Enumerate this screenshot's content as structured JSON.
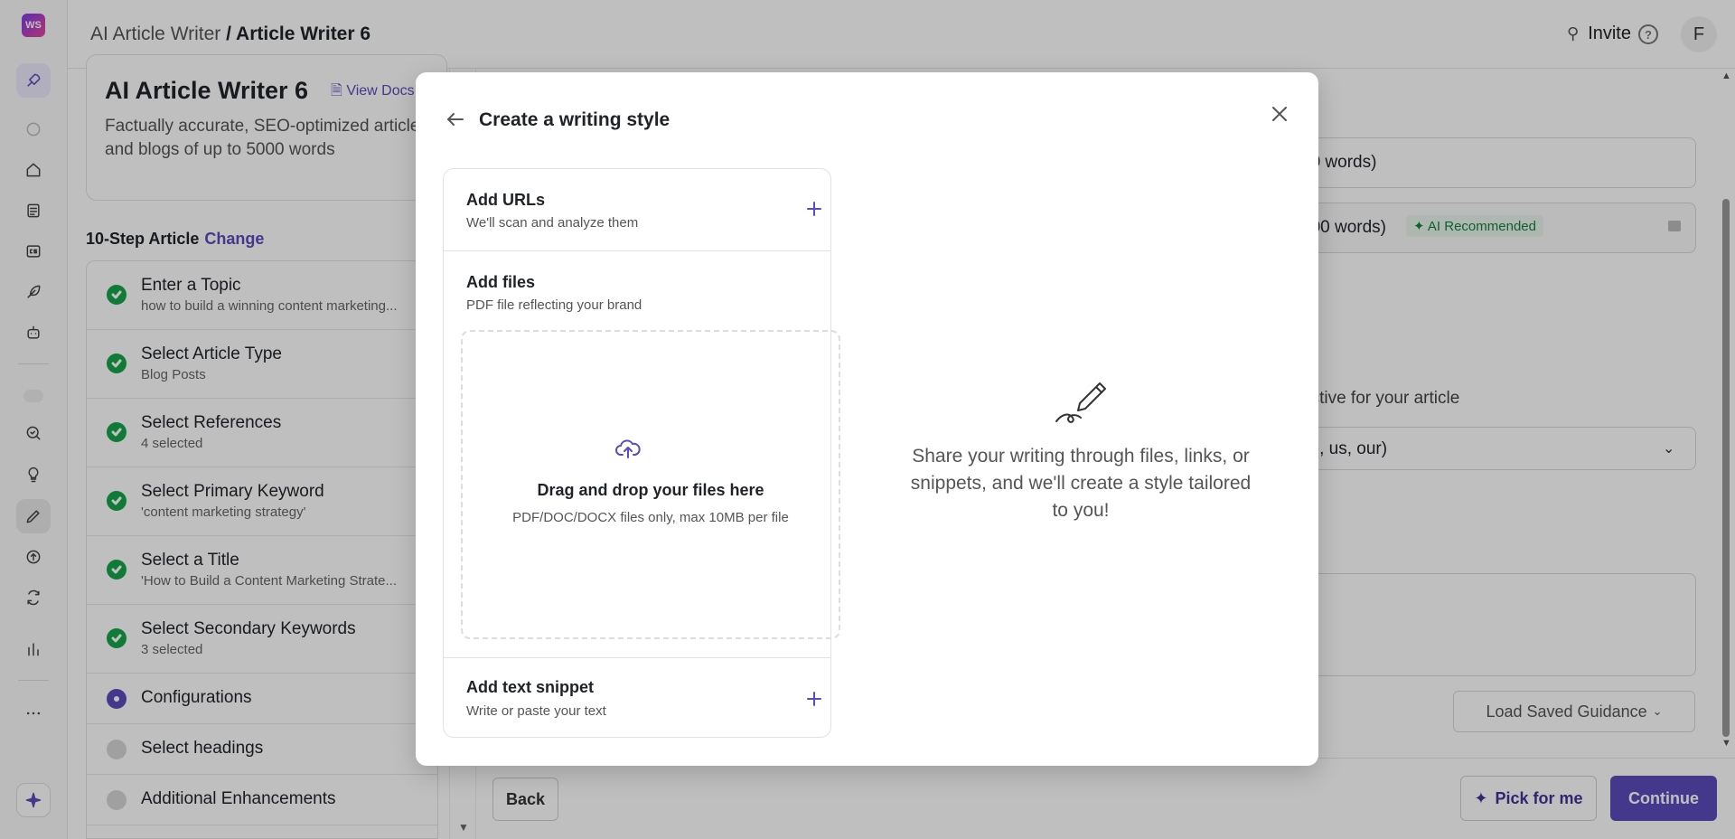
{
  "app": {
    "logo_text": "WS"
  },
  "header": {
    "breadcrumb_parent": "AI Article Writer",
    "breadcrumb_sep": " / ",
    "breadcrumb_current": "Article Writer 6",
    "invite_label": "Invite",
    "help_label": "?",
    "avatar_initial": "F"
  },
  "card": {
    "title": "AI Article Writer 6",
    "docs_label": "View Docs",
    "description": "Factually accurate, SEO-optimized articles and blogs of up to 5000 words"
  },
  "steps": {
    "heading": "10-Step Article",
    "change_label": "Change",
    "items": [
      {
        "label": "Enter a Topic",
        "sub": "how to build a winning content marketing...",
        "status": "done"
      },
      {
        "label": "Select Article Type",
        "sub": "Blog Posts",
        "status": "done"
      },
      {
        "label": "Select References",
        "sub": "4 selected",
        "status": "done"
      },
      {
        "label": "Select Primary Keyword",
        "sub": "'content marketing strategy'",
        "status": "done"
      },
      {
        "label": "Select a Title",
        "sub": "'How to Build a Content Marketing Strate...",
        "status": "done"
      },
      {
        "label": "Select Secondary Keywords",
        "sub": "3 selected",
        "status": "done"
      },
      {
        "label": "Configurations",
        "sub": "",
        "status": "current"
      },
      {
        "label": "Select headings",
        "sub": "",
        "status": "pending"
      },
      {
        "label": "Additional Enhancements",
        "sub": "",
        "status": "pending"
      }
    ]
  },
  "config": {
    "option1_text": "00 words)",
    "option2_text": "000 words)",
    "ai_badge": "AI Recommended",
    "perspective_text": "ective for your article",
    "select_value": "ve, us, our)",
    "load_guidance_label": "Load Saved Guidance"
  },
  "footer": {
    "back_label": "Back",
    "pick_label": "Pick for me",
    "continue_label": "Continue"
  },
  "modal": {
    "title": "Create a writing style",
    "urls_title": "Add URLs",
    "urls_sub": "We'll scan and analyze them",
    "files_title": "Add files",
    "files_sub": "PDF file reflecting your brand",
    "drop_title": "Drag and drop your files here",
    "drop_hint": "PDF/DOC/DOCX files only, max 10MB per file",
    "snippet_title": "Add text snippet",
    "snippet_sub": "Write or paste your text",
    "share_text": "Share your writing through files, links, or snippets, and we'll create a style tailored to you!"
  },
  "colors": {
    "accent": "#5b4bbd",
    "success": "#16a34a",
    "overlay": "rgba(0,0,0,0.25)"
  },
  "icons": {
    "rail": [
      "rocket-icon",
      "spinner-icon",
      "home-icon",
      "document-icon",
      "cs-icon",
      "feather-icon",
      "bot-icon",
      "search-icon",
      "bulb-icon",
      "pencil-icon",
      "upload-icon",
      "refresh-icon",
      "chart-icon",
      "more-icon",
      "sparkle-icon"
    ]
  }
}
